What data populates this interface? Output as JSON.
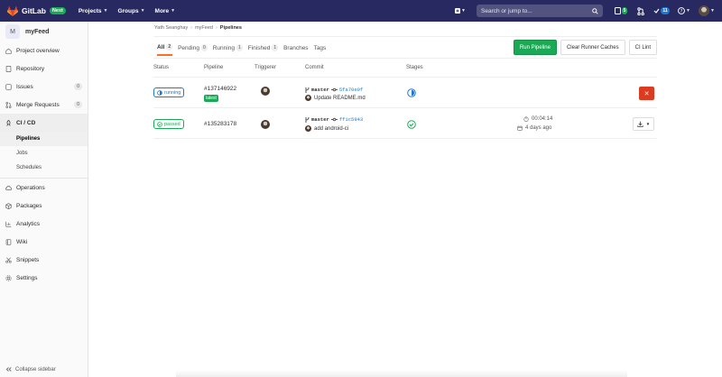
{
  "nav": {
    "brand": "GitLab",
    "badge": "Next",
    "links": [
      "Projects",
      "Groups",
      "More"
    ],
    "search_placeholder": "Search or jump to...",
    "counts": {
      "issues": "5",
      "mrs": "11"
    }
  },
  "sidebar": {
    "project_initial": "M",
    "project_name": "myFeed",
    "items": [
      {
        "label": "Project overview",
        "icon": "home-icon"
      },
      {
        "label": "Repository",
        "icon": "doc-icon"
      },
      {
        "label": "Issues",
        "icon": "issues-icon",
        "count": "0"
      },
      {
        "label": "Merge Requests",
        "icon": "merge-icon",
        "count": "0"
      },
      {
        "label": "CI / CD",
        "icon": "rocket-icon"
      }
    ],
    "sub_items": [
      "Pipelines",
      "Jobs",
      "Schedules"
    ],
    "items_after": [
      {
        "label": "Operations",
        "icon": "cloud-icon"
      },
      {
        "label": "Packages",
        "icon": "package-icon"
      },
      {
        "label": "Analytics",
        "icon": "chart-icon"
      },
      {
        "label": "Wiki",
        "icon": "book-icon"
      },
      {
        "label": "Snippets",
        "icon": "scissors-icon"
      },
      {
        "label": "Settings",
        "icon": "gear-icon"
      }
    ],
    "collapse": "Collapse sidebar"
  },
  "breadcrumb": [
    "Yath Seanghay",
    "myFeed",
    "Pipelines"
  ],
  "tabs": [
    {
      "label": "All",
      "count": "2"
    },
    {
      "label": "Pending",
      "count": "0"
    },
    {
      "label": "Running",
      "count": "1"
    },
    {
      "label": "Finished",
      "count": "1"
    },
    {
      "label": "Branches"
    },
    {
      "label": "Tags"
    }
  ],
  "actions": [
    "Run Pipeline",
    "Clear Runner Caches",
    "CI Lint"
  ],
  "columns": [
    "Status",
    "Pipeline",
    "Triggerer",
    "Commit",
    "Stages"
  ],
  "pipelines": [
    {
      "status": "running",
      "id": "#137146922",
      "badge": "latest",
      "branch": "master",
      "sha": "5fa70e0f",
      "message": "Update README.md"
    },
    {
      "status": "passed",
      "id": "#135283178",
      "branch": "master",
      "sha": "ff1c5943",
      "message": "add android-ci",
      "duration": "00:04:14",
      "finished": "4 days ago"
    }
  ],
  "colors": {
    "nav": "#292961",
    "green": "#1aaa55",
    "blue": "#1f78d1",
    "red": "#db3b21",
    "orange": "#fc6d26"
  }
}
